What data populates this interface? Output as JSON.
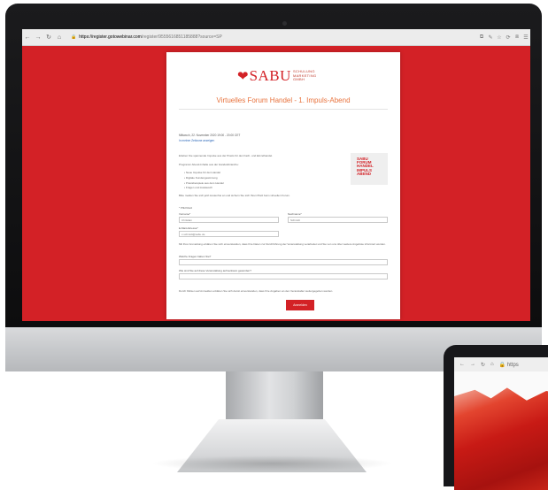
{
  "browser": {
    "url_host": "https://register.gotowebinar.com",
    "url_path": "/register/9555616851185888?source=SP",
    "nav_back": "←",
    "nav_forward": "→",
    "nav_reload": "↻",
    "nav_home": "⌂",
    "lock": "🔒",
    "ext_icons": [
      "⧉",
      "✎",
      "☆",
      "⟳",
      "⧈",
      "☰"
    ]
  },
  "card": {
    "logo_heart": "❤",
    "logo_text": "SABU",
    "logo_sub": [
      "SCHULUNG",
      "MARKETING",
      "GMBH"
    ],
    "event_title": "Virtuelles Forum Handel - 1. Impuls-Abend",
    "date": "Mittwoch, 22. November 2020 19:00 - 20:00 CET",
    "timezone_link": "In meiner Zeitzone anzeigen",
    "intro": "Erleben Sie spannende Impulse aus der Praxis für den Fach- und Einzelhandel.",
    "program_label": "Programm Abend-Inhalte aus der Handelsbranche:",
    "bullets": [
      "Neue Impulse für den Handel",
      "Digitale Kundengewinnung",
      "Praxisbeispiele aus dem Handel",
      "Fragen und Austausch"
    ],
    "promo_lines": [
      "SABU",
      "FORUM",
      "HANDEL",
      "IMPULS",
      "ABEND"
    ],
    "notice": "Bitte melden Sie sich jetzt kostenfrei an und sichern Sie sich Ihren Platz beim virtuellen Forum.",
    "required_hint": "* Pflichtfeld",
    "first_name_label": "Vorname*",
    "first_name_value": "Christian",
    "last_name_label": "Nachname*",
    "last_name_value": "Schmidt",
    "email_label": "E-Mail-Adresse*",
    "email_value": "c.schmidt@sabu.de",
    "consent_text": "Mit Ihrer Anmeldung erklären Sie sich einverstanden, dass Ihre Daten zur Durchführung der Veranstaltung verarbeitet und Sie von uns über weitere Angebote informiert werden.",
    "question1_label": "Welche Fragen haben Sie?",
    "question2_label": "Wie sind Sie auf diese Veranstaltung aufmerksam geworden?",
    "footer_text": "Durch Klicken auf Anmelden erklären Sie sich damit einverstanden, dass Ihre Angaben an den Veranstalter weitergegeben werden.",
    "submit_label": "Anmelden"
  },
  "tablet": {
    "nav_back": "←",
    "nav_forward": "→",
    "nav_reload": "↻",
    "nav_home": "⌂",
    "url": "🔒 https"
  },
  "colors": {
    "brand_red": "#d32126",
    "title_orange": "#e8733e",
    "link_blue": "#2a66b8"
  }
}
